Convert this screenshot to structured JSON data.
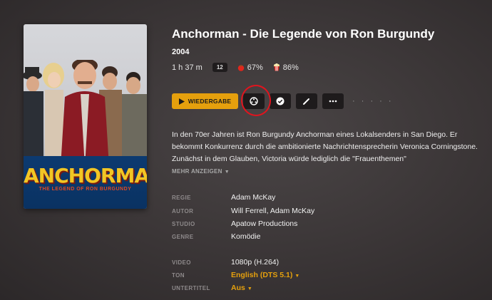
{
  "movie": {
    "title": "Anchorman - Die Legende von Ron Burgundy",
    "year": "2004",
    "duration": "1 h 37 m",
    "age_rating": "12",
    "critic_score": "67%",
    "audience_score": "86%"
  },
  "poster": {
    "logo_text": "ANCHORMAN",
    "tagline": "THE LEGEND OF RON BURGUNDY"
  },
  "toolbar": {
    "play_label": "WIEDERGABE",
    "more_label": "· · · · ·",
    "icons": [
      "play-icon",
      "film-reel-icon",
      "checkmark-icon",
      "pencil-icon",
      "ellipsis-icon"
    ]
  },
  "description": {
    "text": "In den 70er Jahren ist Ron Burgundy Anchorman eines Lokalsenders in San Diego. Er bekommt Konkurrenz durch die ambitionierte Nachrichtensprecherin Veronica Corningstone. Zunächst in dem Glauben, Victoria würde lediglich die \"Frauenthemen\"",
    "show_more": "MEHR ANZEIGEN"
  },
  "details": {
    "regie_label": "REGIE",
    "regie_value": "Adam McKay",
    "autor_label": "AUTOR",
    "autor_value": "Will Ferrell, Adam McKay",
    "studio_label": "STUDIO",
    "studio_value": "Apatow Productions",
    "genre_label": "GENRE",
    "genre_value": "Komödie",
    "video_label": "VIDEO",
    "video_value": "1080p (H.264)",
    "ton_label": "TON",
    "ton_value": "English (DTS 5.1)",
    "untertitel_label": "UNTERTITEL",
    "untertitel_value": "Aus"
  },
  "colors": {
    "accent": "#e5a00d",
    "annotation": "#e0141e",
    "background": "#3a3536"
  }
}
